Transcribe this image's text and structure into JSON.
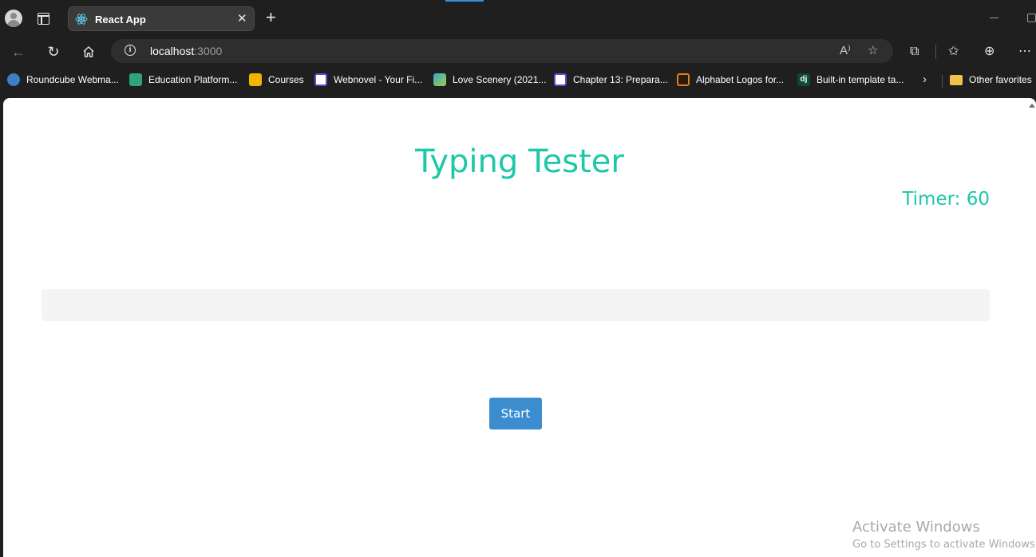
{
  "browser": {
    "tab": {
      "title": "React App",
      "close": "✕"
    },
    "new_tab": "+",
    "address": {
      "host": "localhost",
      "port": ":3000"
    }
  },
  "favorites": [
    {
      "label": "Roundcube Webma...",
      "icon": "roundcube-icon",
      "color": "#3d7fc4"
    },
    {
      "label": "Education Platform...",
      "icon": "education-icon",
      "color": "#2fa37a"
    },
    {
      "label": "Courses",
      "icon": "classroom-icon",
      "color": "#f2b600"
    },
    {
      "label": "Webnovel - Your Fi...",
      "icon": "webnovel-icon",
      "color": "#5b4bd6"
    },
    {
      "label": "Love Scenery (2021...",
      "icon": "scenery-icon",
      "color": "#3aa7c9"
    },
    {
      "label": "Chapter 13: Prepara...",
      "icon": "webnovel-icon",
      "color": "#5b4bd6"
    },
    {
      "label": "Alphabet Logos for...",
      "icon": "alphabet-icon",
      "color": "#e07b1f"
    },
    {
      "label": "Built-in template ta...",
      "icon": "django-icon",
      "color": "#0c4b33",
      "glyph": "dj"
    },
    {
      "label": "Other favorites",
      "icon": "folder-icon",
      "color": "#f1c14b"
    }
  ],
  "app": {
    "title": "Typing Tester",
    "timer": "Timer: 60",
    "start_label": "Start",
    "accent_color": "#1cc8a8",
    "button_color": "#3b8dd0"
  },
  "watermark": {
    "title": "Activate Windows",
    "subtitle": "Go to Settings to activate Windows."
  }
}
